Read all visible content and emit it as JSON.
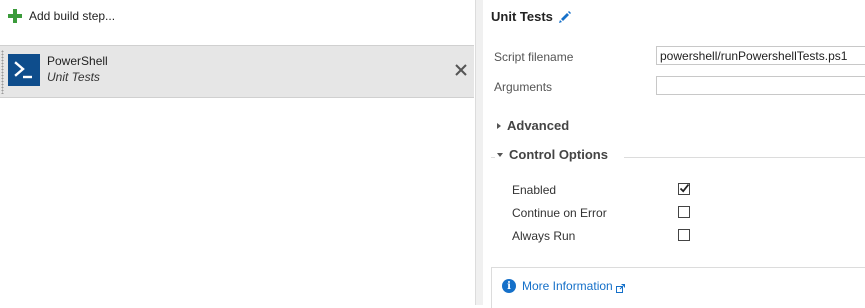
{
  "build_steps": {
    "add_label": "Add build step...",
    "items": [
      {
        "name": "PowerShell",
        "subtitle": "Unit Tests"
      }
    ]
  },
  "task": {
    "title": "Unit Tests",
    "fields": {
      "script_filename_label": "Script filename",
      "script_filename_value": "powershell/runPowershellTests.ps1",
      "arguments_label": "Arguments",
      "arguments_value": ""
    },
    "sections": {
      "advanced": "Advanced",
      "control_options": "Control Options"
    },
    "control_options": [
      {
        "label": "Enabled",
        "checked": true
      },
      {
        "label": "Continue on Error",
        "checked": false
      },
      {
        "label": "Always Run",
        "checked": false
      }
    ],
    "more_info": "More Information"
  },
  "icons": {
    "add": "plus-icon",
    "task": "powershell-icon",
    "remove": "close-icon",
    "edit": "pencil-icon",
    "expand": "triangle-right-icon",
    "collapse": "triangle-down-icon",
    "info": "info-icon",
    "external": "external-link-icon"
  },
  "colors": {
    "accent": "#1570c9",
    "add_green": "#3b9b3b",
    "powershell_blue": "#0e4d8c",
    "selected_row": "#e6e6e6"
  }
}
